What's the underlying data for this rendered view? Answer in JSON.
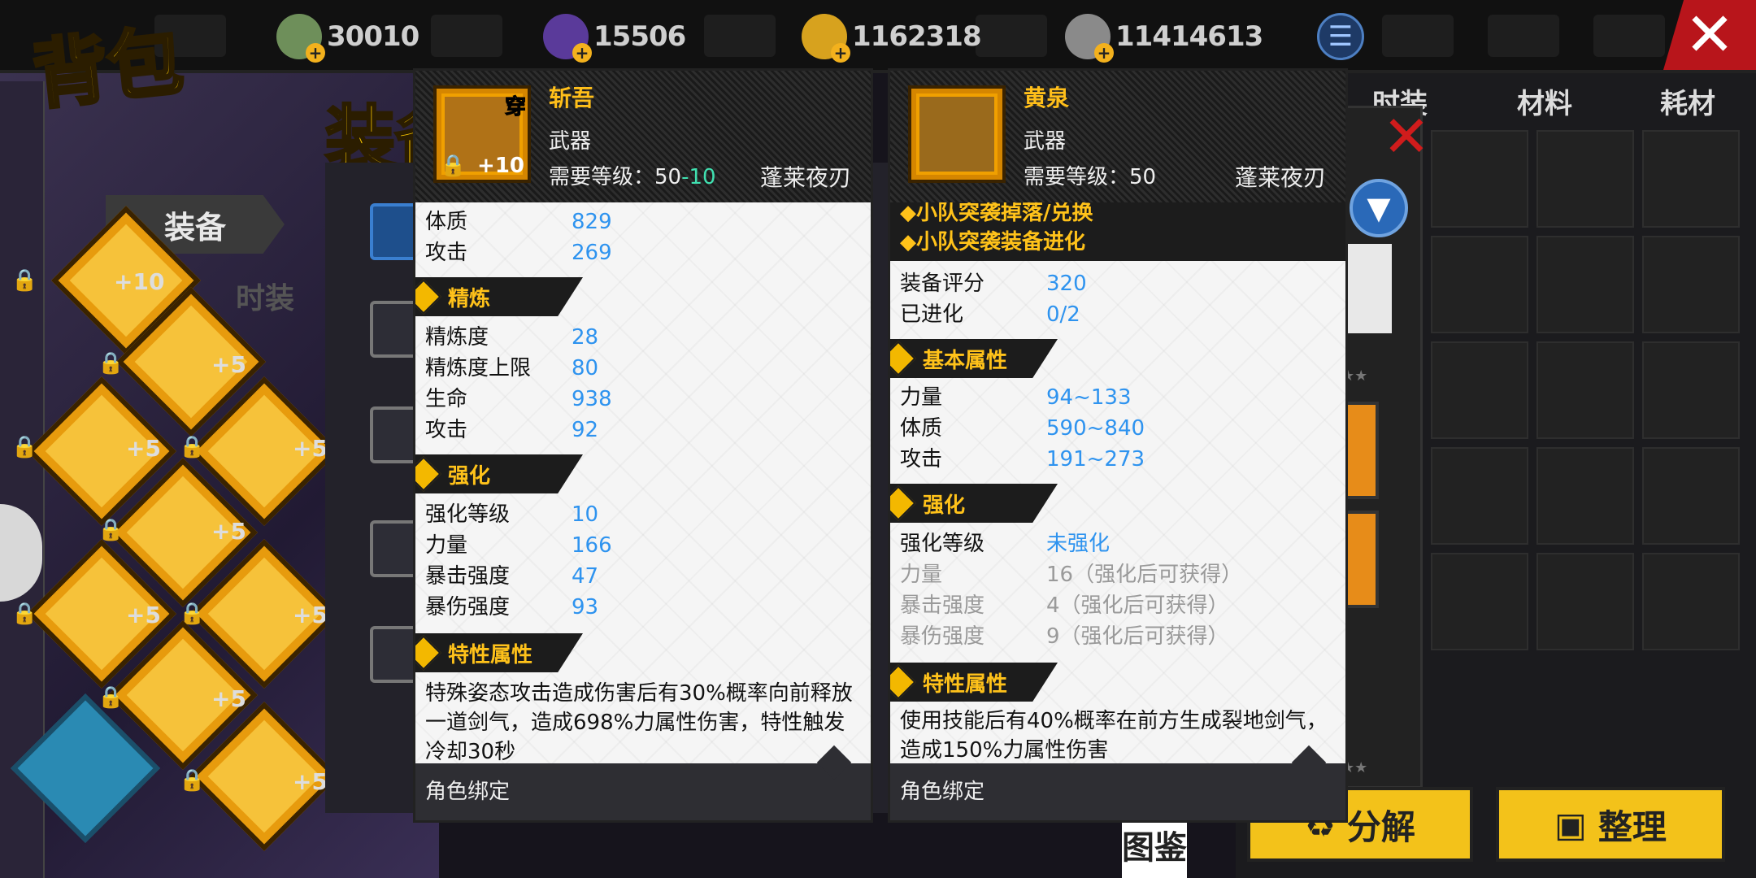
{
  "title": "背包",
  "currencies": [
    {
      "icon": "cash-icon",
      "value": "30010"
    },
    {
      "icon": "crystal-icon",
      "value": "15506"
    },
    {
      "icon": "gold-coin-icon",
      "value": "1162318"
    },
    {
      "icon": "silver-coin-icon",
      "value": "11414613"
    }
  ],
  "left": {
    "equip_tab": "装备",
    "fashion_tab": "时装",
    "big_heading": "装备",
    "slots": [
      {
        "level": "+10"
      },
      {
        "level": "+5"
      },
      {
        "level": "+5"
      },
      {
        "level": "+5"
      },
      {
        "level": "+5"
      },
      {
        "level": "+5"
      },
      {
        "level": "+5"
      },
      {
        "level": "+5"
      },
      {
        "level": "+5"
      }
    ]
  },
  "right_tabs": [
    "时装",
    "材料",
    "耗材"
  ],
  "buttons": {
    "decompose": "分解",
    "organize": "整理",
    "atlas": "图鉴"
  },
  "card_left": {
    "name": "斩吾",
    "badge": "穿",
    "enhance": "+10",
    "type": "武器",
    "req_label": "需要等级：",
    "req_base": "50",
    "req_delta": "-10",
    "set": "蓬莱夜刃",
    "top_stats": [
      {
        "k": "体质",
        "v": "829"
      },
      {
        "k": "攻击",
        "v": "269"
      }
    ],
    "sections": [
      {
        "title": "精炼",
        "rows": [
          {
            "k": "精炼度",
            "v": "28"
          },
          {
            "k": "精炼度上限",
            "v": "80"
          },
          {
            "k": "生命",
            "v": "938"
          },
          {
            "k": "攻击",
            "v": "92"
          }
        ]
      },
      {
        "title": "强化",
        "rows": [
          {
            "k": "强化等级",
            "v": "10"
          },
          {
            "k": "力量",
            "v": "166"
          },
          {
            "k": "暴击强度",
            "v": "47"
          },
          {
            "k": "暴伤强度",
            "v": "93"
          }
        ]
      }
    ],
    "trait_title": "特性属性",
    "trait_text": "特殊姿态攻击造成伤害后有30%概率向前释放一道剑气，造成698%力属性伤害，特性触发冷却30秒",
    "footer": "角色绑定"
  },
  "card_right": {
    "name": "黄泉",
    "type": "武器",
    "req_label": "需要等级：",
    "req_base": "50",
    "set": "蓬莱夜刃",
    "links": [
      "小队突袭掉落/兑换",
      "小队突袭装备进化"
    ],
    "top_stats": [
      {
        "k": "装备评分",
        "v": "320"
      },
      {
        "k": "已进化",
        "v": "0/2"
      }
    ],
    "base_title": "基本属性",
    "base_rows": [
      {
        "k": "力量",
        "v": "94~133"
      },
      {
        "k": "体质",
        "v": "590~840"
      },
      {
        "k": "攻击",
        "v": "191~273"
      }
    ],
    "enh_title": "强化",
    "enh_rows": [
      {
        "k": "强化等级",
        "v": "未强化"
      },
      {
        "k": "力量",
        "v": "16（强化后可获得）"
      },
      {
        "k": "暴击强度",
        "v": "4（强化后可获得）"
      },
      {
        "k": "暴伤强度",
        "v": "9（强化后可获得）"
      }
    ],
    "trait_title": "特性属性",
    "trait_text": "使用技能后有40%概率在前方生成裂地剑气，造成150%力属性伤害",
    "footer": "角色绑定"
  },
  "colors": {
    "accent": "#ffc21a",
    "stat_value": "#2e93ef",
    "close_red": "#d01c1c"
  }
}
